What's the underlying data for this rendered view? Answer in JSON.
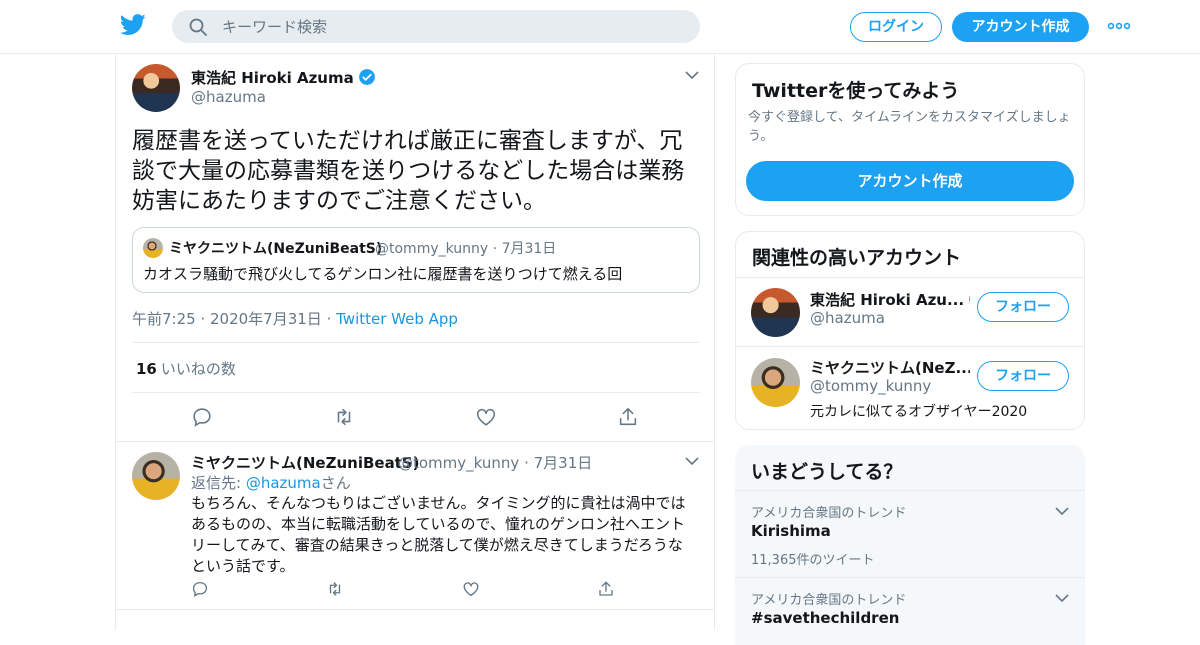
{
  "header": {
    "search_placeholder": "キーワード検索",
    "login_label": "ログイン",
    "signup_label": "アカウント作成"
  },
  "tweet": {
    "author_name": "東浩紀 Hiroki Azuma",
    "author_handle": "@hazuma",
    "text": "履歴書を送っていただければ厳正に審査しますが、冗談で大量の応募書類を送りつけるなどした場合は業務妨害にあたりますのでご注意ください。",
    "quote": {
      "author_name": "ミヤクニツトム(NeZuniBeatS)",
      "author_handle": "@tommy_kunny",
      "date": "7月31日",
      "text": "カオスラ騒動で飛び火してるゲンロン社に履歴書を送りつけて燃える回"
    },
    "time": "午前7:25",
    "date": "2020年7月31日",
    "source": "Twitter Web App",
    "likes_count": "16",
    "likes_label": "いいねの数"
  },
  "reply": {
    "author_name": "ミヤクニツトム(NeZuniBeatS)",
    "author_handle": "@tommy_kunny",
    "date": "7月31日",
    "reply_to_label": "返信先:",
    "reply_to_handle": "@hazuma",
    "reply_to_suffix": "さん",
    "text": "もちろん、そんなつもりはございません。タイミング的に貴社は渦中ではあるものの、本当に転職活動をしているので、憧れのゲンロン社へエントリーしてみて、審査の結果きっと脱落して僕が燃え尽きてしまうだろうなという話です。"
  },
  "sidebar": {
    "signup_card": {
      "title": "Twitterを使ってみよう",
      "subtitle": "今すぐ登録して、タイムラインをカスタマイズしましょう。",
      "button_label": "アカウント作成"
    },
    "related": {
      "title": "関連性の高いアカウント",
      "accounts": [
        {
          "name": "東浩紀 Hiroki Azu...",
          "handle": "@hazuma",
          "bio": "",
          "follow_label": "フォロー"
        },
        {
          "name": "ミヤクニツトム(NeZ...",
          "handle": "@tommy_kunny",
          "bio": "元カレに似てるオブザイヤー2020",
          "follow_label": "フォロー"
        }
      ]
    },
    "trends": {
      "title": "いまどうしてる？",
      "items": [
        {
          "context": "アメリカ合衆国のトレンド",
          "name": "Kirishima",
          "count": "11,365件のツイート"
        },
        {
          "context": "アメリカ合衆国のトレンド",
          "name": "#savethechildren",
          "count": ""
        }
      ]
    }
  },
  "colors": {
    "accent": "#1da1f2",
    "link": "#1b95e0",
    "muted": "#657786",
    "border": "#e6ecf0"
  }
}
